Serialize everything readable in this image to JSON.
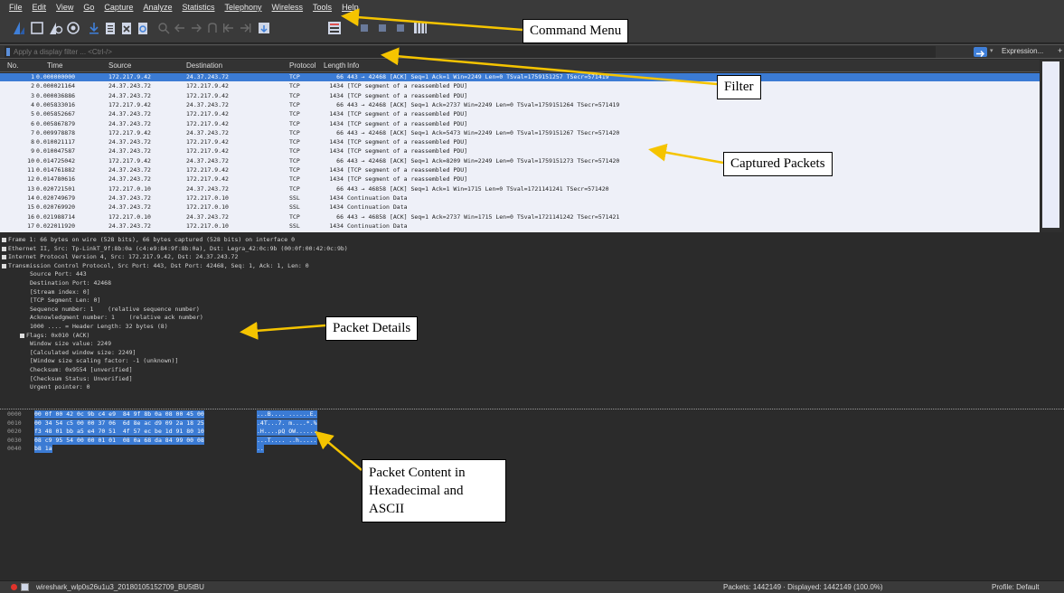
{
  "menu": [
    "File",
    "Edit",
    "View",
    "Go",
    "Capture",
    "Analyze",
    "Statistics",
    "Telephony",
    "Wireless",
    "Tools",
    "Help"
  ],
  "filter": {
    "placeholder": "Apply a display filter ... <Ctrl-/>",
    "expression_label": "Expression...",
    "plus_label": "+"
  },
  "columns": {
    "no": "No.",
    "time": "Time",
    "source": "Source",
    "destination": "Destination",
    "protocol": "Protocol",
    "length": "Length",
    "info": "Info"
  },
  "packets": [
    {
      "no": "1",
      "time": "0.000000000",
      "src": "172.217.9.42",
      "dst": "24.37.243.72",
      "proto": "TCP",
      "len": "66",
      "info": "443 → 42468 [ACK] Seq=1 Ack=1 Win=2249 Len=0 TSval=1759151257 TSecr=571419"
    },
    {
      "no": "2",
      "time": "0.000021164",
      "src": "24.37.243.72",
      "dst": "172.217.9.42",
      "proto": "TCP",
      "len": "1434",
      "info": "[TCP segment of a reassembled PDU]"
    },
    {
      "no": "3",
      "time": "0.000036886",
      "src": "24.37.243.72",
      "dst": "172.217.9.42",
      "proto": "TCP",
      "len": "1434",
      "info": "[TCP segment of a reassembled PDU]"
    },
    {
      "no": "4",
      "time": "0.005833016",
      "src": "172.217.9.42",
      "dst": "24.37.243.72",
      "proto": "TCP",
      "len": "66",
      "info": "443 → 42468 [ACK] Seq=1 Ack=2737 Win=2249 Len=0 TSval=1759151264 TSecr=571419"
    },
    {
      "no": "5",
      "time": "0.005852667",
      "src": "24.37.243.72",
      "dst": "172.217.9.42",
      "proto": "TCP",
      "len": "1434",
      "info": "[TCP segment of a reassembled PDU]"
    },
    {
      "no": "6",
      "time": "0.005867879",
      "src": "24.37.243.72",
      "dst": "172.217.9.42",
      "proto": "TCP",
      "len": "1434",
      "info": "[TCP segment of a reassembled PDU]"
    },
    {
      "no": "7",
      "time": "0.009978878",
      "src": "172.217.9.42",
      "dst": "24.37.243.72",
      "proto": "TCP",
      "len": "66",
      "info": "443 → 42468 [ACK] Seq=1 Ack=5473 Win=2249 Len=0 TSval=1759151267 TSecr=571420"
    },
    {
      "no": "8",
      "time": "0.010021117",
      "src": "24.37.243.72",
      "dst": "172.217.9.42",
      "proto": "TCP",
      "len": "1434",
      "info": "[TCP segment of a reassembled PDU]"
    },
    {
      "no": "9",
      "time": "0.010047587",
      "src": "24.37.243.72",
      "dst": "172.217.9.42",
      "proto": "TCP",
      "len": "1434",
      "info": "[TCP segment of a reassembled PDU]"
    },
    {
      "no": "10",
      "time": "0.014725042",
      "src": "172.217.9.42",
      "dst": "24.37.243.72",
      "proto": "TCP",
      "len": "66",
      "info": "443 → 42468 [ACK] Seq=1 Ack=8209 Win=2249 Len=0 TSval=1759151273 TSecr=571420"
    },
    {
      "no": "11",
      "time": "0.014761882",
      "src": "24.37.243.72",
      "dst": "172.217.9.42",
      "proto": "TCP",
      "len": "1434",
      "info": "[TCP segment of a reassembled PDU]"
    },
    {
      "no": "12",
      "time": "0.014780616",
      "src": "24.37.243.72",
      "dst": "172.217.9.42",
      "proto": "TCP",
      "len": "1434",
      "info": "[TCP segment of a reassembled PDU]"
    },
    {
      "no": "13",
      "time": "0.020721501",
      "src": "172.217.0.10",
      "dst": "24.37.243.72",
      "proto": "TCP",
      "len": "66",
      "info": "443 → 46858 [ACK] Seq=1 Ack=1 Win=1715 Len=0 TSval=1721141241 TSecr=571420"
    },
    {
      "no": "14",
      "time": "0.020749679",
      "src": "24.37.243.72",
      "dst": "172.217.0.10",
      "proto": "SSL",
      "len": "1434",
      "info": "Continuation Data"
    },
    {
      "no": "15",
      "time": "0.020769920",
      "src": "24.37.243.72",
      "dst": "172.217.0.10",
      "proto": "SSL",
      "len": "1434",
      "info": "Continuation Data"
    },
    {
      "no": "16",
      "time": "0.021988714",
      "src": "172.217.0.10",
      "dst": "24.37.243.72",
      "proto": "TCP",
      "len": "66",
      "info": "443 → 46858 [ACK] Seq=1 Ack=2737 Win=1715 Len=0 TSval=1721141242 TSecr=571421"
    },
    {
      "no": "17",
      "time": "0.022011920",
      "src": "24.37.243.72",
      "dst": "172.217.0.10",
      "proto": "SSL",
      "len": "1434",
      "info": "Continuation Data"
    }
  ],
  "details": [
    {
      "text": "Frame 1: 66 bytes on wire (528 bits), 66 bytes captured (528 bits) on interface 0",
      "expander": true,
      "indent": 0
    },
    {
      "text": "Ethernet II, Src: Tp-LinkT_9f:8b:0a (c4:e9:84:9f:8b:0a), Dst: Legra_42:0c:9b (00:0f:00:42:0c:9b)",
      "expander": true,
      "indent": 0
    },
    {
      "text": "Internet Protocol Version 4, Src: 172.217.9.42, Dst: 24.37.243.72",
      "expander": true,
      "indent": 0
    },
    {
      "text": "Transmission Control Protocol, Src Port: 443, Dst Port: 42468, Seq: 1, Ack: 1, Len: 0",
      "expander": true,
      "indent": 0
    },
    {
      "text": "Source Port: 443",
      "expander": false,
      "indent": 1
    },
    {
      "text": "Destination Port: 42468",
      "expander": false,
      "indent": 1
    },
    {
      "text": "[Stream index: 0]",
      "expander": false,
      "indent": 1
    },
    {
      "text": "[TCP Segment Len: 0]",
      "expander": false,
      "indent": 1
    },
    {
      "text": "Sequence number: 1    (relative sequence number)",
      "expander": false,
      "indent": 1
    },
    {
      "text": "Acknowledgment number: 1    (relative ack number)",
      "expander": false,
      "indent": 1
    },
    {
      "text": "1000 .... = Header Length: 32 bytes (8)",
      "expander": false,
      "indent": 1
    },
    {
      "text": "Flags: 0x010 (ACK)",
      "expander": true,
      "indent": 1
    },
    {
      "text": "Window size value: 2249",
      "expander": false,
      "indent": 1
    },
    {
      "text": "[Calculated window size: 2249]",
      "expander": false,
      "indent": 1
    },
    {
      "text": "[Window size scaling factor: -1 (unknown)]",
      "expander": false,
      "indent": 1
    },
    {
      "text": "Checksum: 0x9554 [unverified]",
      "expander": false,
      "indent": 1
    },
    {
      "text": "[Checksum Status: Unverified]",
      "expander": false,
      "indent": 1
    },
    {
      "text": "Urgent pointer: 0",
      "expander": false,
      "indent": 1
    }
  ],
  "hex": [
    {
      "offset": "0000",
      "bytes": "00 0f 00 42 0c 9b c4 e9  84 9f 8b 0a 08 00 45 00",
      "ascii": "...B.... ......E."
    },
    {
      "offset": "0010",
      "bytes": "00 34 54 c5 00 00 37 06  6d 8e ac d9 09 2a 18 25",
      "ascii": ".4T...7. m....*.%"
    },
    {
      "offset": "0020",
      "bytes": "f3 48 01 bb a5 e4 70 51  4f 57 ec be 1d 91 80 10",
      "ascii": ".H....pQ OW......"
    },
    {
      "offset": "0030",
      "bytes": "08 c9 95 54 00 00 01 01  08 0a 68 da 84 99 00 08",
      "ascii": "...T.... ..h....."
    },
    {
      "offset": "0040",
      "bytes": "b8 1a",
      "ascii": ".."
    }
  ],
  "status": {
    "file": "wireshark_wlp0s26u1u3_20180105152709_BU5tBU",
    "packets": "Packets: 1442149 · Displayed: 1442149 (100.0%)",
    "profile": "Profile: Default"
  },
  "callouts": {
    "command_menu": "Command Menu",
    "filter": "Filter",
    "captured_packets": "Captured Packets",
    "packet_details": "Packet Details",
    "packet_content": "Packet Content in Hexadecimal and ASCII"
  },
  "colors": {
    "selection": "#3b7bd4",
    "packet_list_bg": "#eef0f8",
    "annotation_arrow": "#f5c400"
  }
}
